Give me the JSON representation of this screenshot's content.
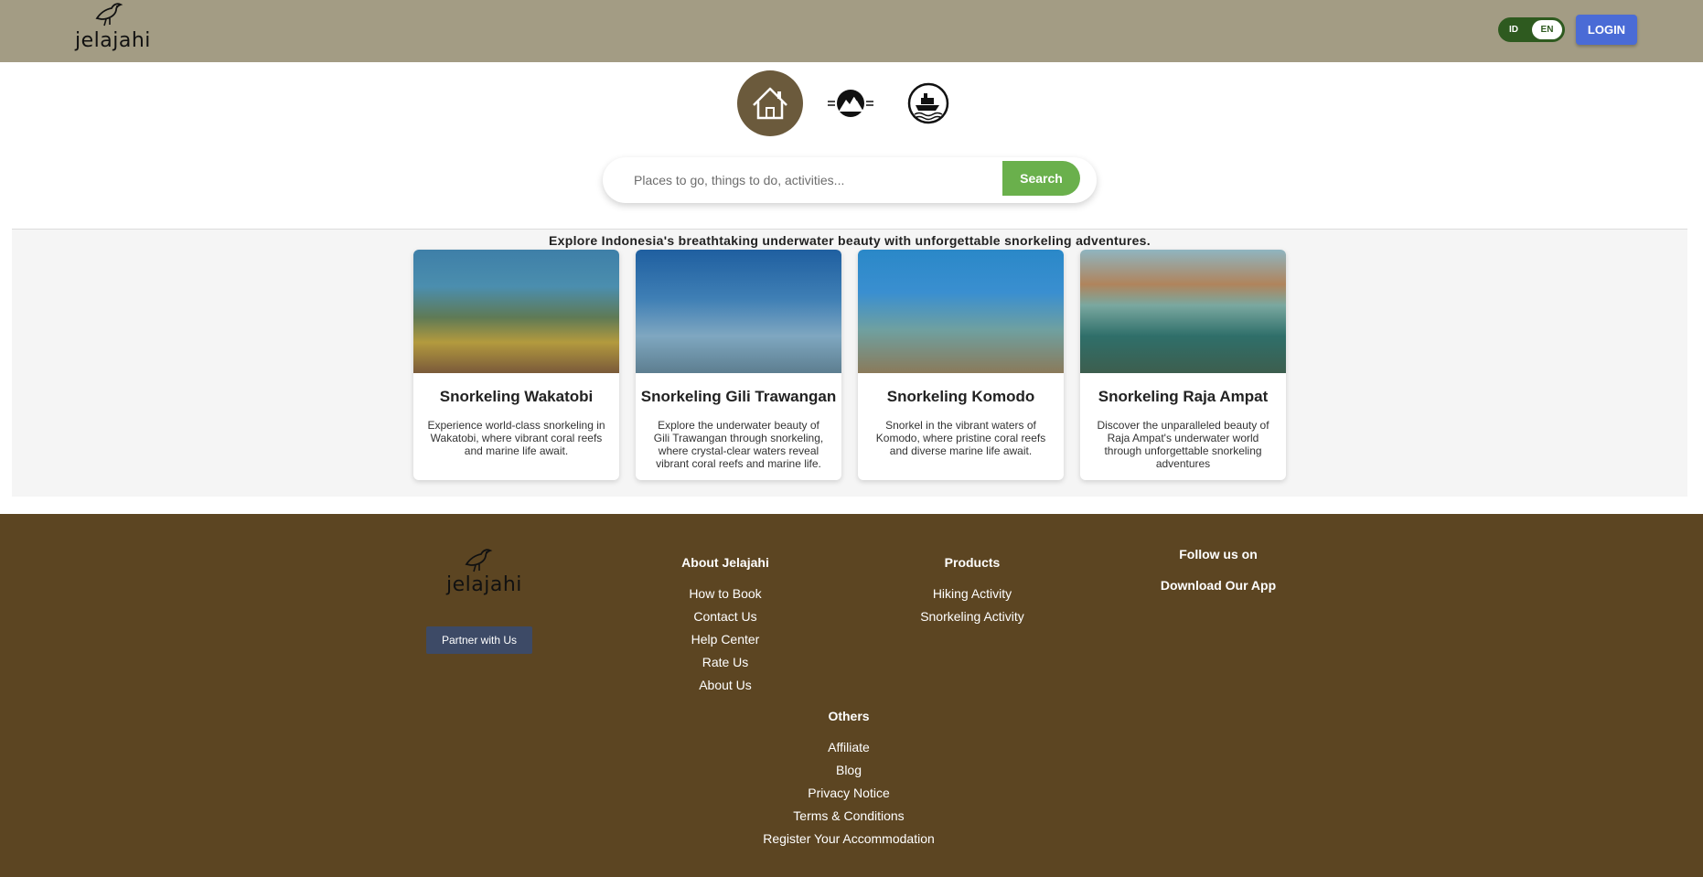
{
  "header": {
    "logo_text": "jelajahi",
    "lang": {
      "id": "ID",
      "en": "EN"
    },
    "login_label": "LOGIN"
  },
  "categories": [
    {
      "name": "Home",
      "icon": "home-icon"
    },
    {
      "name": "Hiking",
      "icon": "mountain-icon"
    },
    {
      "name": "Snorkeling",
      "icon": "boat-icon"
    }
  ],
  "search": {
    "placeholder": "Places to go, things to do, activities...",
    "button_label": "Search"
  },
  "main": {
    "tagline": "Explore Indonesia's breathtaking underwater beauty with unforgettable snorkeling adventures.",
    "cards": [
      {
        "title": "Snorkeling Wakatobi",
        "desc": "Experience world-class snorkeling in Wakatobi, where vibrant coral reefs and marine life await."
      },
      {
        "title": "Snorkeling Gili Trawangan",
        "desc": "Explore the underwater beauty of Gili Trawangan through snorkeling, where crystal-clear waters reveal vibrant coral reefs and marine life."
      },
      {
        "title": "Snorkeling Komodo",
        "desc": "Snorkel in the vibrant waters of Komodo, where pristine coral reefs and diverse marine life await."
      },
      {
        "title": "Snorkeling Raja Ampat",
        "desc": "Discover the unparalleled beauty of Raja Ampat's underwater world through unforgettable snorkeling adventures"
      }
    ]
  },
  "footer": {
    "logo_text": "jelajahi",
    "partner_label": "Partner with Us",
    "about": {
      "heading": "About Jelajahi",
      "links": [
        "How to Book",
        "Contact Us",
        "Help Center",
        "Rate Us",
        "About Us"
      ]
    },
    "products": {
      "heading": "Products",
      "links": [
        "Hiking Activity",
        "Snorkeling Activity"
      ]
    },
    "follow_heading": "Follow us on",
    "download_heading": "Download Our App",
    "others": {
      "heading": "Others",
      "links": [
        "Affiliate",
        "Blog",
        "Privacy Notice",
        "Terms & Conditions",
        "Register Your Accommodation"
      ]
    }
  },
  "colors": {
    "header_bg": "#a39c84",
    "login_button": "#4a6bd6",
    "search_button": "#6ab04c",
    "footer_bg": "#5c4522",
    "partner_button": "#3d4a66",
    "lang_toggle": "#2e5a1f"
  }
}
